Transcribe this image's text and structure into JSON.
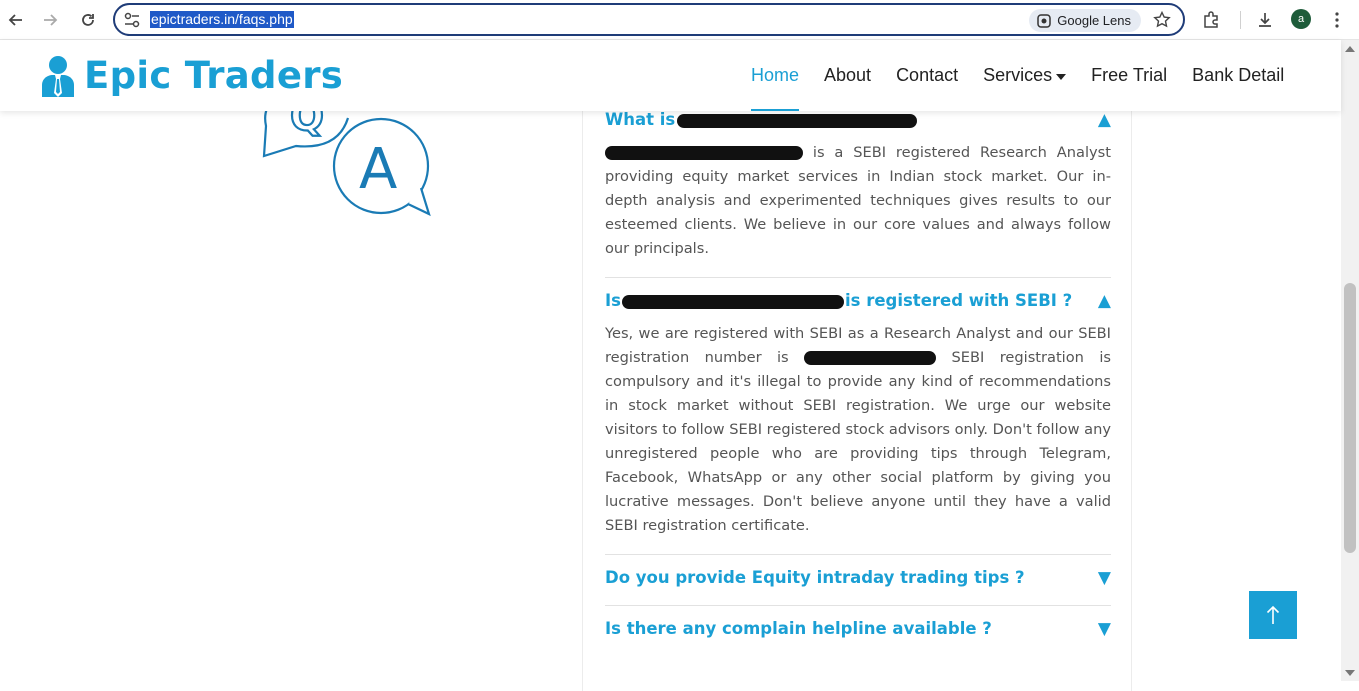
{
  "browser": {
    "url": "epictraders.in/faqs.php",
    "lens_label": "Google Lens",
    "profile_initial": "a"
  },
  "site": {
    "brand": "Epic Traders",
    "nav": [
      {
        "label": "Home"
      },
      {
        "label": "About"
      },
      {
        "label": "Contact"
      },
      {
        "label": "Services"
      },
      {
        "label": "Free Trial"
      },
      {
        "label": "Bank Detail"
      }
    ]
  },
  "faqs": [
    {
      "q_prefix": "What is",
      "q_suffix": "",
      "arrow": "▲",
      "answer_tail": "is a SEBI registered Research Analyst providing equity market services in Indian stock market. Our in-depth analysis and experimented techniques gives results to our esteemed clients. We believe in our core values and always follow our principals."
    },
    {
      "q_prefix": "Is",
      "q_suffix": "is registered with SEBI ?",
      "arrow": "▲",
      "answer_head": "Yes, we are registered with SEBI as a Research Analyst and our SEBI registration number is",
      "answer_tail": "SEBI registration is compulsory and it's illegal to provide any kind of recommendations in stock market without SEBI registration. We urge our website visitors to follow SEBI registered stock advisors only. Don't follow any unregistered people who are providing tips through Telegram, Facebook, WhatsApp or any other social platform by giving you lucrative messages. Don't believe anyone until they have a valid SEBI registration certificate."
    },
    {
      "question": "Do you provide Equity intraday trading tips ?",
      "arrow": "▼"
    },
    {
      "question": "Is there any complain helpline available ?",
      "arrow": "▼"
    }
  ],
  "art": {
    "q_letter": "Q",
    "a_letter": "A"
  },
  "colors": {
    "accent": "#1a9fd4",
    "text": "#555555"
  }
}
